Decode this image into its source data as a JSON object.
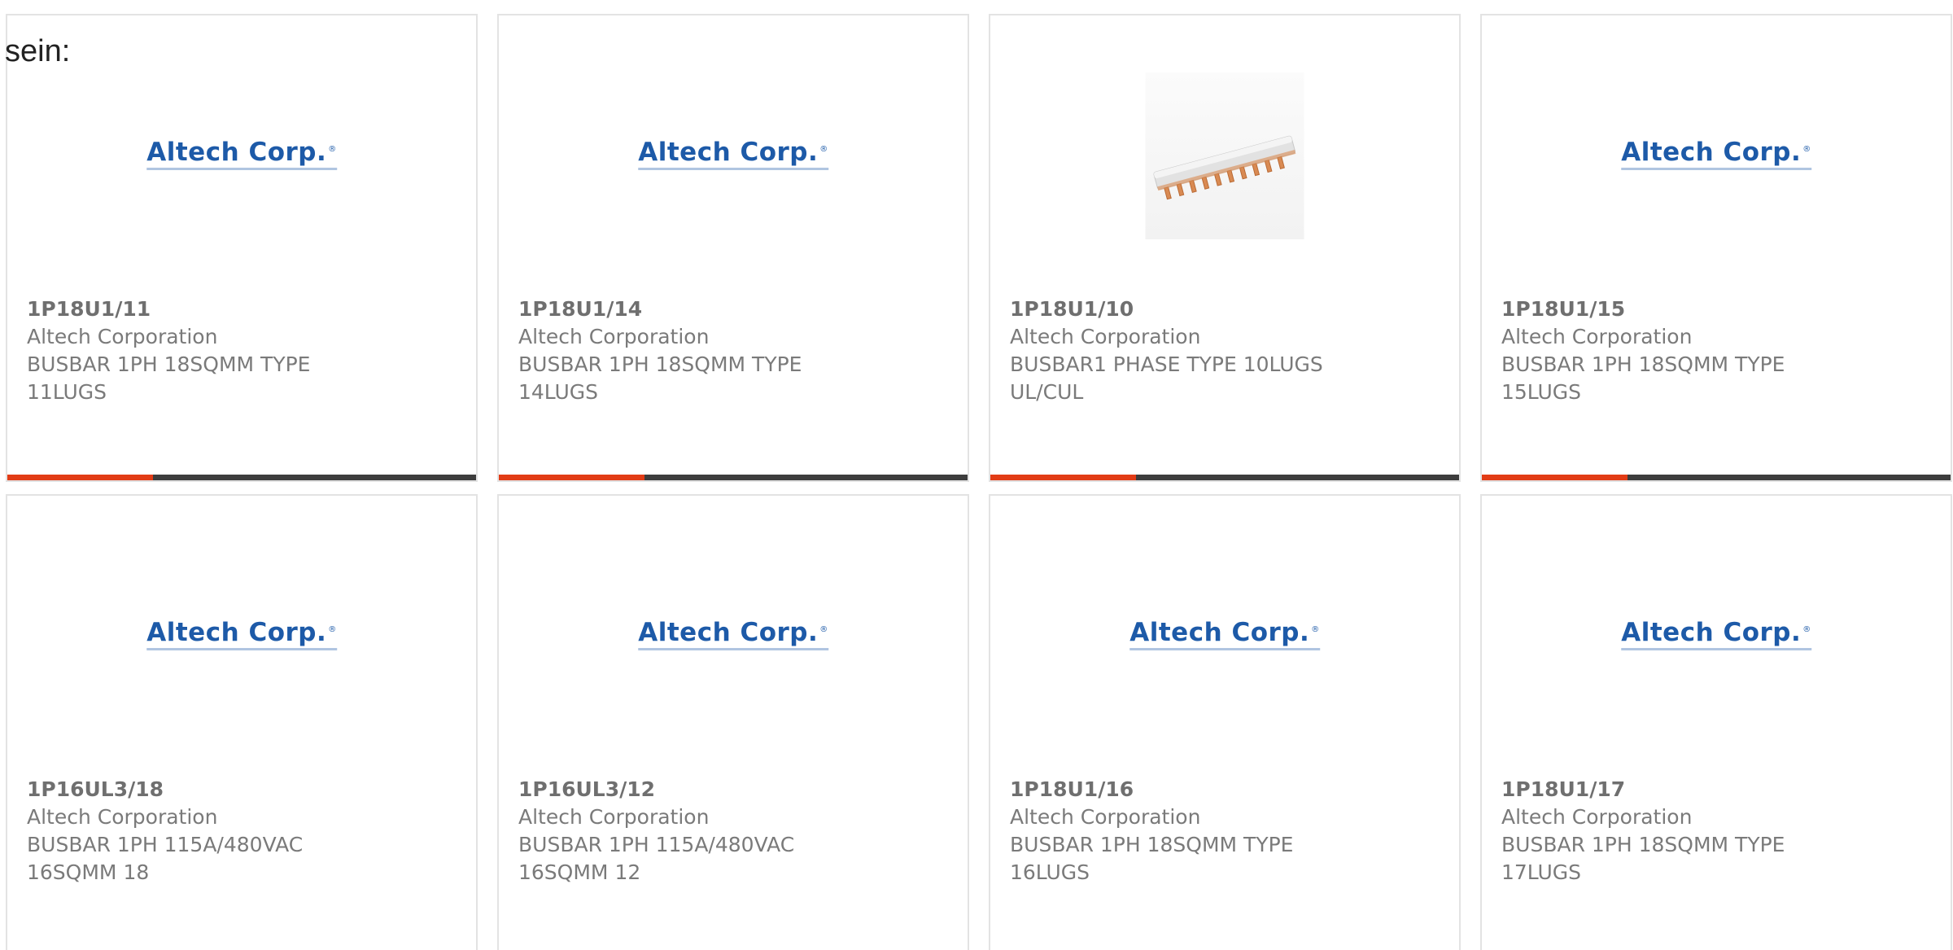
{
  "intro_text": "sein:",
  "colors": {
    "accent": "#e23c16",
    "bar_track": "#3d3d3d",
    "logo_blue": "#1d5aa8"
  },
  "logo_text": "Altech Corp.",
  "cards": [
    {
      "part": "1P18U1/11",
      "maker": "Altech Corporation",
      "desc": "BUSBAR 1PH 18SQMM TYPE 11LUGS",
      "image": "logo",
      "progress": 0.31
    },
    {
      "part": "1P18U1/14",
      "maker": "Altech Corporation",
      "desc": "BUSBAR 1PH 18SQMM TYPE 14LUGS",
      "image": "logo",
      "progress": 0.31
    },
    {
      "part": "1P18U1/10",
      "maker": "Altech Corporation",
      "desc": "BUSBAR1 PHASE TYPE 10LUGS UL/CUL",
      "image": "busbar-photo",
      "progress": 0.31
    },
    {
      "part": "1P18U1/15",
      "maker": "Altech Corporation",
      "desc": "BUSBAR 1PH 18SQMM TYPE 15LUGS",
      "image": "logo",
      "progress": 0.31
    },
    {
      "part": "1P16UL3/18",
      "maker": "Altech Corporation",
      "desc": "BUSBAR 1PH 115A/480VAC 16SQMM 18",
      "image": "logo"
    },
    {
      "part": "1P16UL3/12",
      "maker": "Altech Corporation",
      "desc": "BUSBAR 1PH 115A/480VAC 16SQMM 12",
      "image": "logo"
    },
    {
      "part": "1P18U1/16",
      "maker": "Altech Corporation",
      "desc": "BUSBAR 1PH 18SQMM TYPE 16LUGS",
      "image": "logo"
    },
    {
      "part": "1P18U1/17",
      "maker": "Altech Corporation",
      "desc": "BUSBAR 1PH 18SQMM TYPE 17LUGS",
      "image": "logo"
    }
  ]
}
